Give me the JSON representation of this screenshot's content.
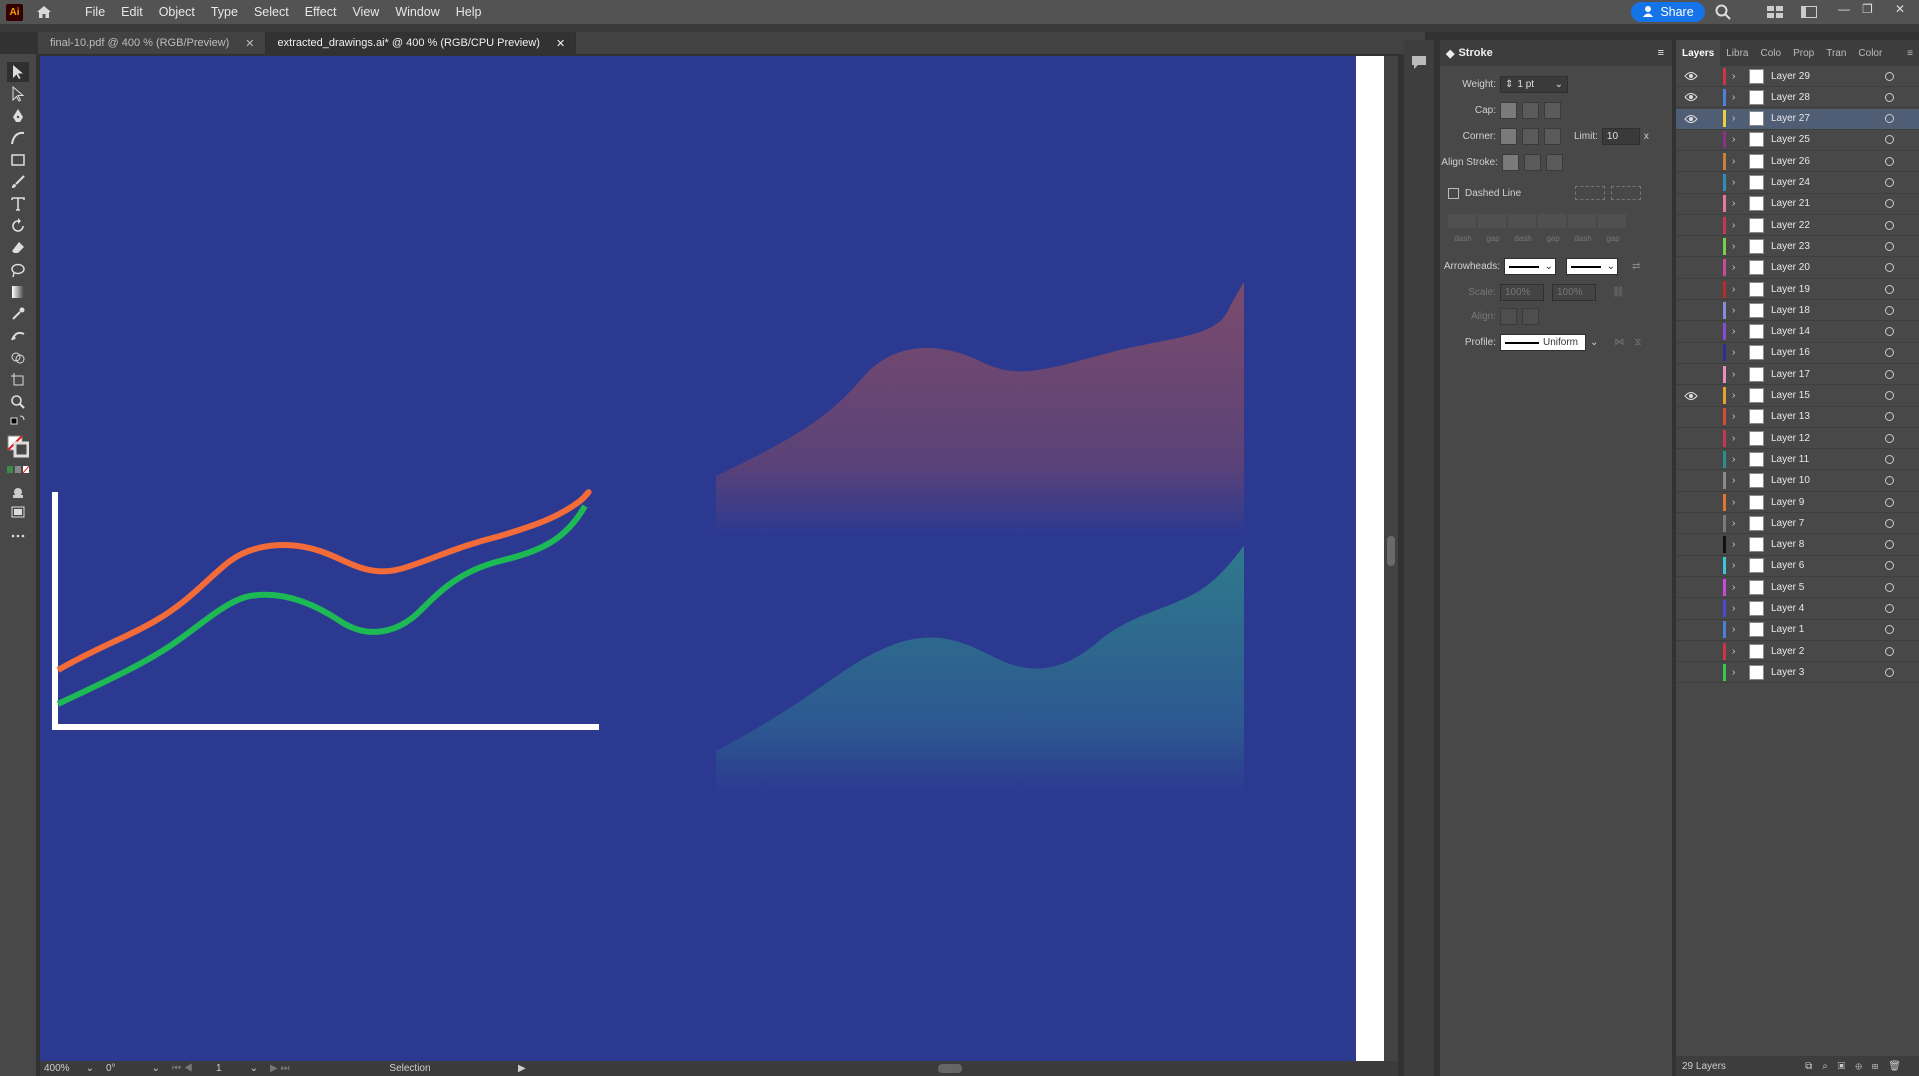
{
  "app": {
    "logo": "Ai",
    "title": "Adobe Illustrator"
  },
  "menu": {
    "items": [
      "File",
      "Edit",
      "Object",
      "Type",
      "Select",
      "Effect",
      "View",
      "Window",
      "Help"
    ],
    "share_label": "Share"
  },
  "tabs": [
    {
      "label": "final-10.pdf @ 400 % (RGB/Preview)",
      "active": false
    },
    {
      "label": "extracted_drawings.ai* @ 400 % (RGB/CPU Preview)",
      "active": true
    }
  ],
  "status": {
    "zoom": "400%",
    "rotation": "0°",
    "artboard": "1",
    "tool": "Selection"
  },
  "stroke_panel": {
    "title": "Stroke",
    "weight_label": "Weight:",
    "weight_value": "1 pt",
    "cap_label": "Cap:",
    "corner_label": "Corner:",
    "limit_label": "Limit:",
    "limit_value": "10",
    "limit_unit": "x",
    "align_label": "Align Stroke:",
    "dashed_label": "Dashed Line",
    "dash_labels": [
      "dash",
      "gap",
      "dash",
      "gap",
      "dash",
      "gap"
    ],
    "arrowheads_label": "Arrowheads:",
    "scale_label": "Scale:",
    "scale_value1": "100%",
    "scale_value2": "100%",
    "align2_label": "Align:",
    "profile_label": "Profile:",
    "profile_value": "Uniform"
  },
  "layers_panel": {
    "tabs": [
      "Layers",
      "Libra",
      "Colo",
      "Prop",
      "Tran",
      "Color"
    ],
    "count": "29 Layers",
    "layers": [
      {
        "name": "Layer 29",
        "color": "#d0363f",
        "visible": true,
        "selected": false
      },
      {
        "name": "Layer 28",
        "color": "#4f7fde",
        "visible": true,
        "selected": false
      },
      {
        "name": "Layer 27",
        "color": "#e8d13c",
        "visible": true,
        "selected": true
      },
      {
        "name": "Layer 25",
        "color": "#8a2f8a",
        "visible": false,
        "selected": false
      },
      {
        "name": "Layer 26",
        "color": "#c7813a",
        "visible": false,
        "selected": false
      },
      {
        "name": "Layer 24",
        "color": "#2c8fb8",
        "visible": false,
        "selected": false
      },
      {
        "name": "Layer 21",
        "color": "#e87a9a",
        "visible": false,
        "selected": false
      },
      {
        "name": "Layer 22",
        "color": "#c4375a",
        "visible": false,
        "selected": false
      },
      {
        "name": "Layer 23",
        "color": "#7bd04a",
        "visible": false,
        "selected": false
      },
      {
        "name": "Layer 20",
        "color": "#c94a9a",
        "visible": false,
        "selected": false
      },
      {
        "name": "Layer 19",
        "color": "#b42c2c",
        "visible": false,
        "selected": false
      },
      {
        "name": "Layer 18",
        "color": "#8a8ad8",
        "visible": false,
        "selected": false
      },
      {
        "name": "Layer 14",
        "color": "#8a4ad8",
        "visible": false,
        "selected": false
      },
      {
        "name": "Layer 16",
        "color": "#2c2c9a",
        "visible": false,
        "selected": false
      },
      {
        "name": "Layer 17",
        "color": "#e890b8",
        "visible": false,
        "selected": false
      },
      {
        "name": "Layer 15",
        "color": "#e8a030",
        "visible": true,
        "selected": false
      },
      {
        "name": "Layer 13",
        "color": "#d84a3a",
        "visible": false,
        "selected": false
      },
      {
        "name": "Layer 12",
        "color": "#c4375a",
        "visible": false,
        "selected": false
      },
      {
        "name": "Layer 11",
        "color": "#2c8f8f",
        "visible": false,
        "selected": false
      },
      {
        "name": "Layer 10",
        "color": "#8a8a8a",
        "visible": false,
        "selected": false
      },
      {
        "name": "Layer 9",
        "color": "#e8742c",
        "visible": false,
        "selected": false
      },
      {
        "name": "Layer 7",
        "color": "#7a7a7a",
        "visible": false,
        "selected": false
      },
      {
        "name": "Layer 8",
        "color": "#111111",
        "visible": false,
        "selected": false
      },
      {
        "name": "Layer 6",
        "color": "#3ac8d8",
        "visible": false,
        "selected": false
      },
      {
        "name": "Layer 5",
        "color": "#c94ad8",
        "visible": false,
        "selected": false
      },
      {
        "name": "Layer 4",
        "color": "#4a4ad8",
        "visible": false,
        "selected": false
      },
      {
        "name": "Layer 1",
        "color": "#4f7fde",
        "visible": false,
        "selected": false
      },
      {
        "name": "Layer 2",
        "color": "#d0363f",
        "visible": false,
        "selected": false
      },
      {
        "name": "Layer 3",
        "color": "#3ac84a",
        "visible": false,
        "selected": false
      }
    ]
  },
  "colors": {
    "artboard_bg": "#2c3991",
    "orange_line": "#f26b38",
    "green_line": "#1db954",
    "area_top": "#7a4a6e",
    "area_bottom": "#2f7a8a",
    "accent": "#1473e6"
  }
}
